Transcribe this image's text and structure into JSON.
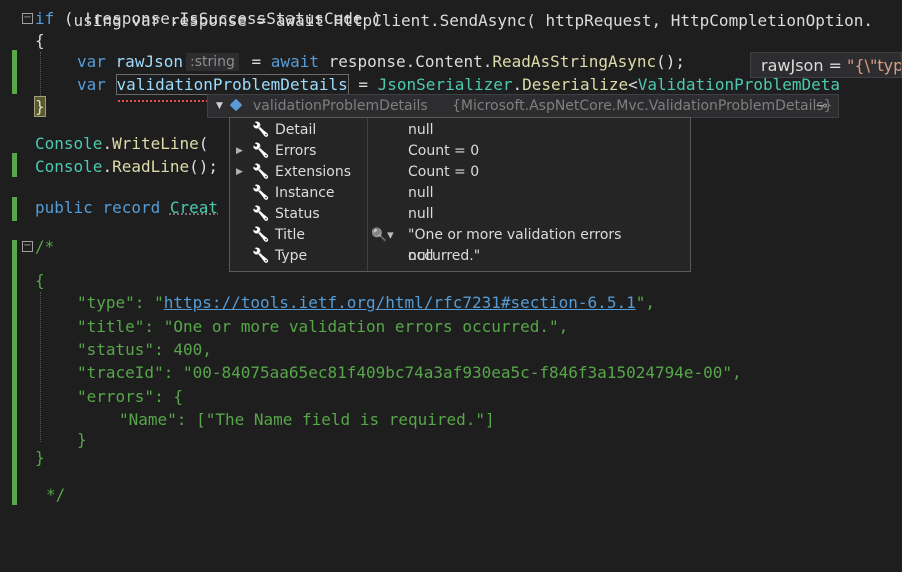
{
  "code": {
    "line_top": "using var response = await HttpClient.SendAsync( httpRequest, HttpCompletionOption.",
    "if_kw": "if",
    "if_rest": " ( !response.IsSuccessStatusCode )",
    "open_brace": "{",
    "var1_kw": "var",
    "var1_name": "rawJson",
    "var1_hint": ":string",
    "var1_eq": " = ",
    "var1_await": "await",
    "var1_rest": " response.Content.",
    "var1_fn": "ReadAsStringAsync",
    "var1_end": "();",
    "var2_kw": "var",
    "var2_name": "validationProblemDetails",
    "var2_eq": " = ",
    "var2_cls": "JsonSerializer",
    "var2_dot": ".",
    "var2_fn": "Deserialize",
    "var2_lt": "<",
    "var2_type": "ValidationProblemDeta",
    "close_brace": "}",
    "console1_cls": "Console",
    "console1_fn": "WriteLine",
    "console1_rest": "(",
    "console2_cls": "Console",
    "console2_fn": "ReadLine",
    "console2_rest": "();",
    "record_kw1": "public",
    "record_kw2": "record",
    "record_name": "Creat",
    "comment_open": "/*",
    "json_open": "{",
    "json_type_key": "\"type\": \"",
    "json_type_link": "https://tools.ietf.org/html/rfc7231#section-6.5.1",
    "json_type_end": "\",",
    "json_title": "\"title\": \"One or more validation errors occurred.\",",
    "json_status": "\"status\": 400,",
    "json_trace": "\"traceId\": \"00-84075aa65ec81f409bc74a3af930ea5c-f846f3a15024794e-00\",",
    "json_errors": "\"errors\": {",
    "json_name": "\"Name\": [\"The Name field is required.\"]",
    "json_inner_close": "}",
    "json_close": "}",
    "comment_close": "*/"
  },
  "datatip_raw": {
    "name": "rawJson",
    "eq": " = ",
    "value": "\"{\\\"typ"
  },
  "datatip": {
    "header_name": "validationProblemDetails",
    "header_type": "{Microsoft.AspNetCore.Mvc.ValidationProblemDetails}",
    "rows": [
      {
        "name": "Detail",
        "value": "null",
        "expandable": false
      },
      {
        "name": "Errors",
        "value": "Count = 0",
        "expandable": true
      },
      {
        "name": "Extensions",
        "value": "Count = 0",
        "expandable": true
      },
      {
        "name": "Instance",
        "value": "null",
        "expandable": false
      },
      {
        "name": "Status",
        "value": "null",
        "expandable": false
      },
      {
        "name": "Title",
        "value": "\"One or more validation errors occurred.\"",
        "expandable": false,
        "has_visualizer": true
      },
      {
        "name": "Type",
        "value": "null",
        "expandable": false
      }
    ]
  },
  "icons": {
    "property": "wrench-icon",
    "expand": "triangle-right-icon",
    "visualizer": "magnifier-icon",
    "object": "cube-icon",
    "pin": "pin-icon"
  },
  "colors": {
    "background": "#1e1e1e",
    "keyword": "#569cd6",
    "identifier": "#9cdcfe",
    "method": "#dcdcaa",
    "type": "#4ec9b0",
    "comment": "#57a64a",
    "change_bar": "#57a64a"
  }
}
